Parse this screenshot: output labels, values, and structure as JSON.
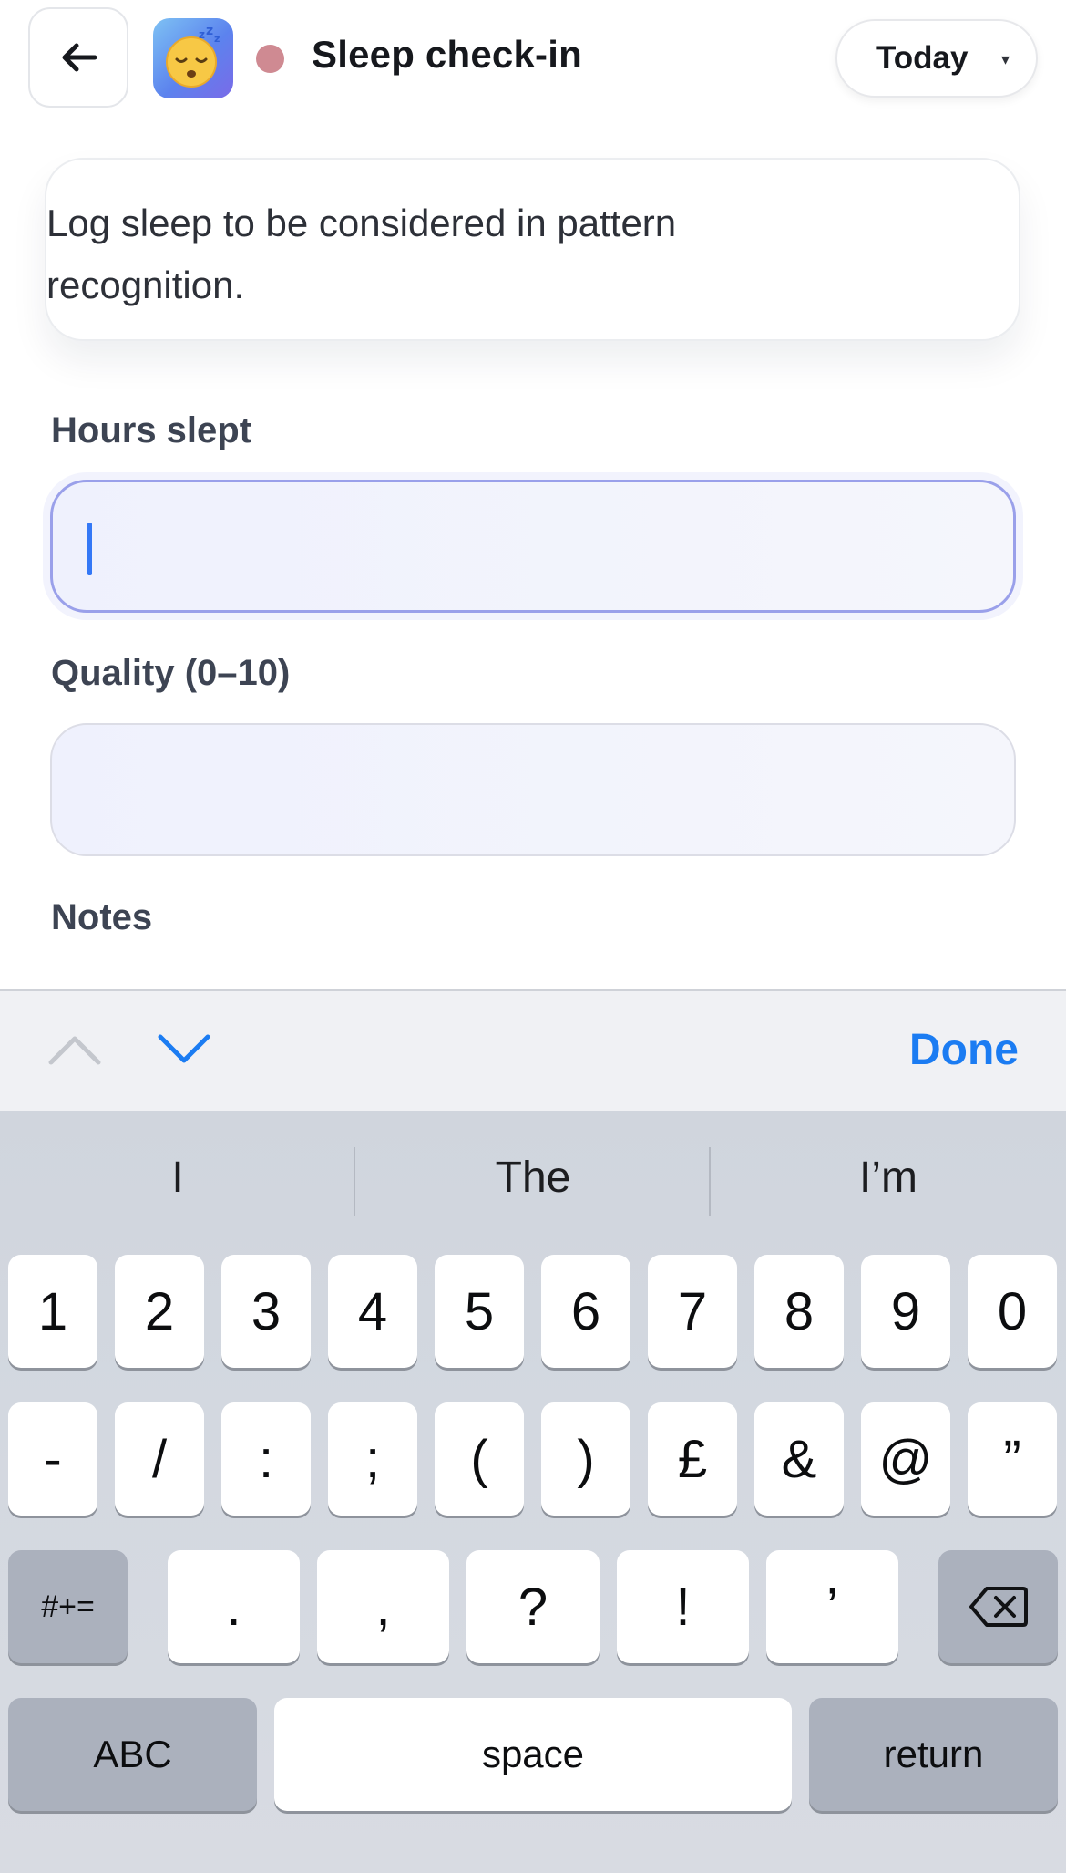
{
  "header": {
    "back_icon": "arrow-left-icon",
    "app_icon": "sleeping-face-icon",
    "status_dot_color": "#cf8a92",
    "title": "Sleep check-in",
    "date_selector": {
      "label": "Today",
      "caret": "▾"
    }
  },
  "info_card": {
    "text": "Log sleep to be considered in pattern recognition."
  },
  "form": {
    "hours": {
      "label": "Hours slept",
      "value": ""
    },
    "quality": {
      "label": "Quality (0–10)",
      "value": ""
    },
    "notes": {
      "label": "Notes"
    }
  },
  "accessory_bar": {
    "previous_icon": "chevron-up-icon",
    "next_icon": "chevron-down-icon",
    "done_label": "Done",
    "accent_color": "#1b7cf2"
  },
  "keyboard": {
    "suggestions": [
      "I",
      "The",
      "I’m"
    ],
    "row1": [
      "1",
      "2",
      "3",
      "4",
      "5",
      "6",
      "7",
      "8",
      "9",
      "0"
    ],
    "row2": [
      "-",
      "/",
      ":",
      ";",
      "(",
      ")",
      "£",
      "&",
      "@",
      "”"
    ],
    "row3": {
      "mode_key": "#+=",
      "keys": [
        ".",
        ",",
        "?",
        "!",
        "’"
      ],
      "delete_icon": "backspace-icon"
    },
    "row4": {
      "abc_key": "ABC",
      "space_key": "space",
      "return_key": "return"
    }
  }
}
